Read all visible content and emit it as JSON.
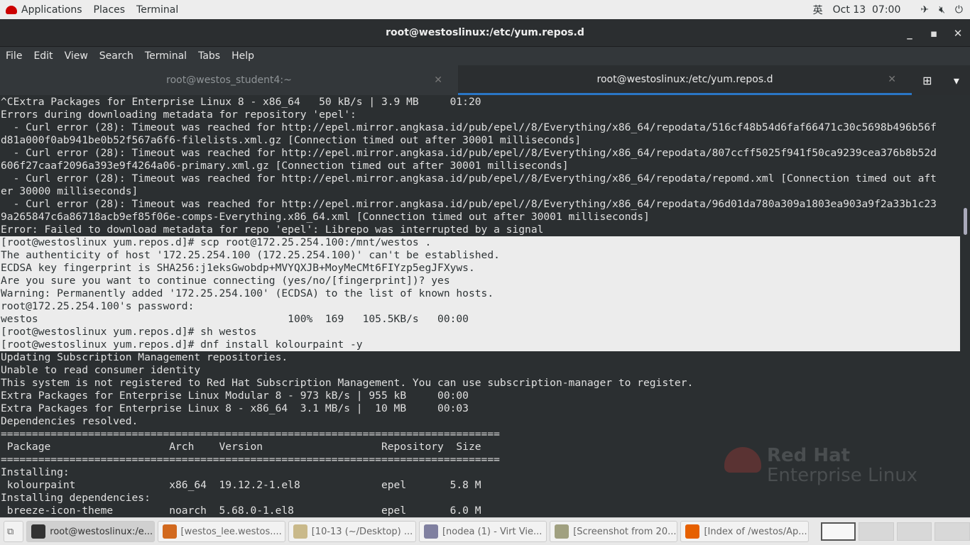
{
  "topbar": {
    "applications": "Applications",
    "places": "Places",
    "terminal": "Terminal",
    "input_method": "英",
    "datetime": "Oct 13  07:00",
    "icons": [
      "airplane-icon",
      "volume-muted-icon",
      "power-icon"
    ]
  },
  "window": {
    "title": "root@westoslinux:/etc/yum.repos.d"
  },
  "menu": [
    "File",
    "Edit",
    "View",
    "Search",
    "Terminal",
    "Tabs",
    "Help"
  ],
  "tabs": [
    {
      "label": "root@westos_student4:~",
      "active": false
    },
    {
      "label": "root@westoslinux:/etc/yum.repos.d",
      "active": true
    }
  ],
  "terminal": {
    "lines": [
      {
        "t": "^CExtra Packages for Enterprise Linux 8 - x86_64   50 kB/s | 3.9 MB     01:20"
      },
      {
        "t": "Errors during downloading metadata for repository 'epel':"
      },
      {
        "t": "  - Curl error (28): Timeout was reached for http://epel.mirror.angkasa.id/pub/epel//8/Everything/x86_64/repodata/516cf48b54d6faf66471c30c5698b496b56f"
      },
      {
        "t": "d81a000f0ab941be0b52f567a6f6-filelists.xml.gz [Connection timed out after 30001 milliseconds]"
      },
      {
        "t": "  - Curl error (28): Timeout was reached for http://epel.mirror.angkasa.id/pub/epel//8/Everything/x86_64/repodata/807ccff5025f941f50ca9239cea376b8b52d"
      },
      {
        "t": "606f27caaf2096a393e9f4264a06-primary.xml.gz [Connection timed out after 30001 milliseconds]"
      },
      {
        "t": "  - Curl error (28): Timeout was reached for http://epel.mirror.angkasa.id/pub/epel//8/Everything/x86_64/repodata/repomd.xml [Connection timed out aft"
      },
      {
        "t": "er 30000 milliseconds]"
      },
      {
        "t": "  - Curl error (28): Timeout was reached for http://epel.mirror.angkasa.id/pub/epel//8/Everything/x86_64/repodata/96d01da780a309a1803ea903a9f2a33b1c23"
      },
      {
        "t": "9a265847c6a86718acb9ef85f06e-comps-Everything.x86_64.xml [Connection timed out after 30001 milliseconds]"
      },
      {
        "t": "Error: Failed to download metadata for repo 'epel': Librepo was interrupted by a signal"
      },
      {
        "t": "[root@westoslinux yum.repos.d]# scp root@172.25.254.100:/mnt/westos .",
        "sel": true
      },
      {
        "t": "The authenticity of host '172.25.254.100 (172.25.254.100)' can't be established.",
        "sel": true
      },
      {
        "t": "ECDSA key fingerprint is SHA256:j1eksGwobdp+MVYQXJB+MoyMeCMt6FIYzp5egJFXyws.",
        "sel": true
      },
      {
        "t": "Are you sure you want to continue connecting (yes/no/[fingerprint])? yes",
        "sel": true
      },
      {
        "t": "Warning: Permanently added '172.25.254.100' (ECDSA) to the list of known hosts.",
        "sel": true
      },
      {
        "t": "root@172.25.254.100's password: ",
        "sel": true
      },
      {
        "t": "westos                                        100%  169   105.5KB/s   00:00    ",
        "sel": true
      },
      {
        "t": "[root@westoslinux yum.repos.d]# sh westos",
        "sel": true
      },
      {
        "t": "[root@westoslinux yum.repos.d]# dnf install kolourpaint -y",
        "sel": true
      },
      {
        "t": "Updating Subscription Management repositories."
      },
      {
        "t": "Unable to read consumer identity"
      },
      {
        "t": "This system is not registered to Red Hat Subscription Management. You can use subscription-manager to register."
      },
      {
        "t": "Extra Packages for Enterprise Linux Modular 8 - 973 kB/s | 955 kB     00:00    "
      },
      {
        "t": "Extra Packages for Enterprise Linux 8 - x86_64  3.1 MB/s |  10 MB     00:03    "
      },
      {
        "t": "Dependencies resolved."
      },
      {
        "t": "================================================================================"
      },
      {
        "t": " Package                   Arch    Version                   Repository  Size"
      },
      {
        "t": "================================================================================"
      },
      {
        "t": "Installing:"
      },
      {
        "t": " kolourpaint               x86_64  19.12.2-1.el8             epel       5.8 M"
      },
      {
        "t": "Installing dependencies:"
      },
      {
        "t": " breeze-icon-theme         noarch  5.68.0-1.el8              epel       6.0 M"
      }
    ]
  },
  "watermark": {
    "line1": "Red Hat",
    "line2": "Enterprise Linux"
  },
  "taskbar": [
    {
      "label": "root@westoslinux:/e...",
      "active": true,
      "icon": "terminal-icon",
      "color": "#333"
    },
    {
      "label": "[westos_lee.westos....",
      "icon": "vm-icon",
      "color": "#d2691e"
    },
    {
      "label": "[10-13 (~/Desktop) ...",
      "icon": "text-editor-icon",
      "color": "#c9b98a"
    },
    {
      "label": "[nodea (1) - Virt Vie...",
      "icon": "monitor-icon",
      "color": "#8080a0"
    },
    {
      "label": "[Screenshot from 20...",
      "icon": "screenshot-icon",
      "color": "#a0a080"
    },
    {
      "label": "[Index of /westos/Ap...",
      "icon": "firefox-icon",
      "color": "#e66000"
    }
  ]
}
